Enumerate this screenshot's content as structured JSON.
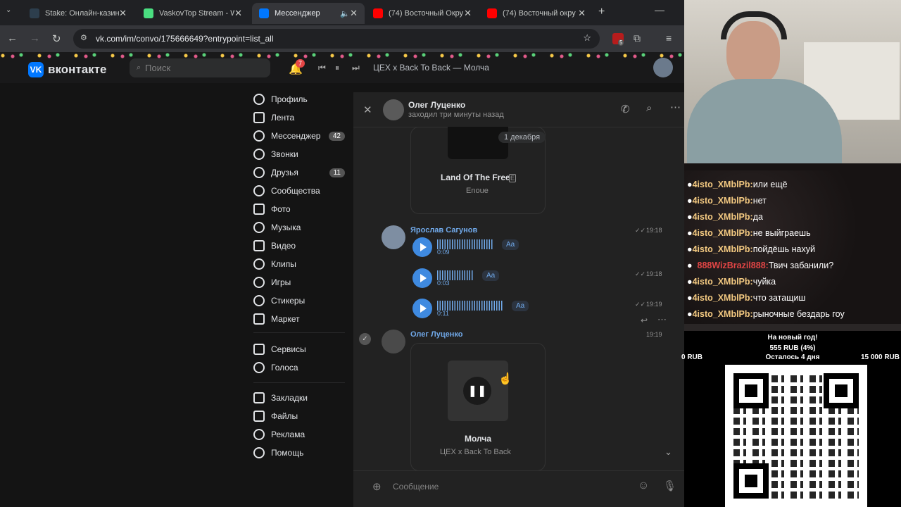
{
  "browser": {
    "tabs": [
      {
        "title": "Stake: Онлайн-казино",
        "color": "#2d3e4d"
      },
      {
        "title": "VaskovTop Stream - W",
        "color": "#4ade80"
      },
      {
        "title": "Мессенджер",
        "color": "#0077ff"
      },
      {
        "title": "(74) Восточный Окру",
        "color": "#ff0000"
      },
      {
        "title": "(74) Восточный окру",
        "color": "#ff0000"
      }
    ],
    "url": "vk.com/im/convo/175666649?entrypoint=list_all",
    "new_tab": "+",
    "ext_badge": "5"
  },
  "vk": {
    "logo": "вконтакте",
    "search_placeholder": "Поиск",
    "notif_count": "7",
    "player_track": "ЦЕХ x Back To Back — Молча",
    "menu": [
      {
        "label": "Профиль",
        "count": ""
      },
      {
        "label": "Лента",
        "count": ""
      },
      {
        "label": "Мессенджер",
        "count": "42"
      },
      {
        "label": "Звонки",
        "count": ""
      },
      {
        "label": "Друзья",
        "count": "11"
      },
      {
        "label": "Сообщества",
        "count": ""
      },
      {
        "label": "Фото",
        "count": ""
      },
      {
        "label": "Музыка",
        "count": ""
      },
      {
        "label": "Видео",
        "count": ""
      },
      {
        "label": "Клипы",
        "count": ""
      },
      {
        "label": "Игры",
        "count": ""
      },
      {
        "label": "Стикеры",
        "count": ""
      },
      {
        "label": "Маркет",
        "count": ""
      }
    ],
    "menu2": [
      {
        "label": "Сервисы"
      },
      {
        "label": "Голоса"
      }
    ],
    "menu3": [
      {
        "label": "Закладки"
      },
      {
        "label": "Файлы"
      },
      {
        "label": "Реклама"
      },
      {
        "label": "Помощь"
      }
    ],
    "chat": {
      "contact_name": "Олег Луценко",
      "status": "заходил три минуты назад",
      "date_badge": "1 декабря",
      "track1_title": "Land Of The Free",
      "track1_artist": "Enoue",
      "sender2": "Ярослав Сагунов",
      "voice": [
        {
          "dur": "0:09",
          "aa": "Aa",
          "time": "19:18"
        },
        {
          "dur": "0:03",
          "aa": "Aa",
          "time": "19:18"
        },
        {
          "dur": "0:11",
          "aa": "Aa",
          "time": "19:19"
        }
      ],
      "sender3": "Олег Луценко",
      "time3": "19:19",
      "track2_title": "Молча",
      "track2_artist": "ЦЕХ x Back To Back",
      "input_placeholder": "Сообщение"
    }
  },
  "stream": {
    "chat": [
      {
        "user": "4isto_XMblPb:",
        "msg": "или ещё"
      },
      {
        "user": "4isto_XMblPb:",
        "msg": "нет"
      },
      {
        "user": "4isto_XMblPb:",
        "msg": "да"
      },
      {
        "user": "4isto_XMblPb:",
        "msg": "не выйграешь"
      },
      {
        "user": "4isto_XMblPb:",
        "msg": "пойдёшь нахуй"
      },
      {
        "user": "888WizBrazil888:",
        "msg": "Твич забанили?"
      },
      {
        "user": "4isto_XMblPb:",
        "msg": "чуйка"
      },
      {
        "user": "4isto_XMblPb:",
        "msg": "что затащиш"
      },
      {
        "user": "4isto_XMblPb:",
        "msg": "рыночные бездарь гоу"
      }
    ],
    "goal_title": "На новый год!",
    "goal_amount": "555 RUB (4%)",
    "goal_min": "0 RUB",
    "goal_remaining": "Осталось 4 дня",
    "goal_max": "15 000 RUB"
  }
}
